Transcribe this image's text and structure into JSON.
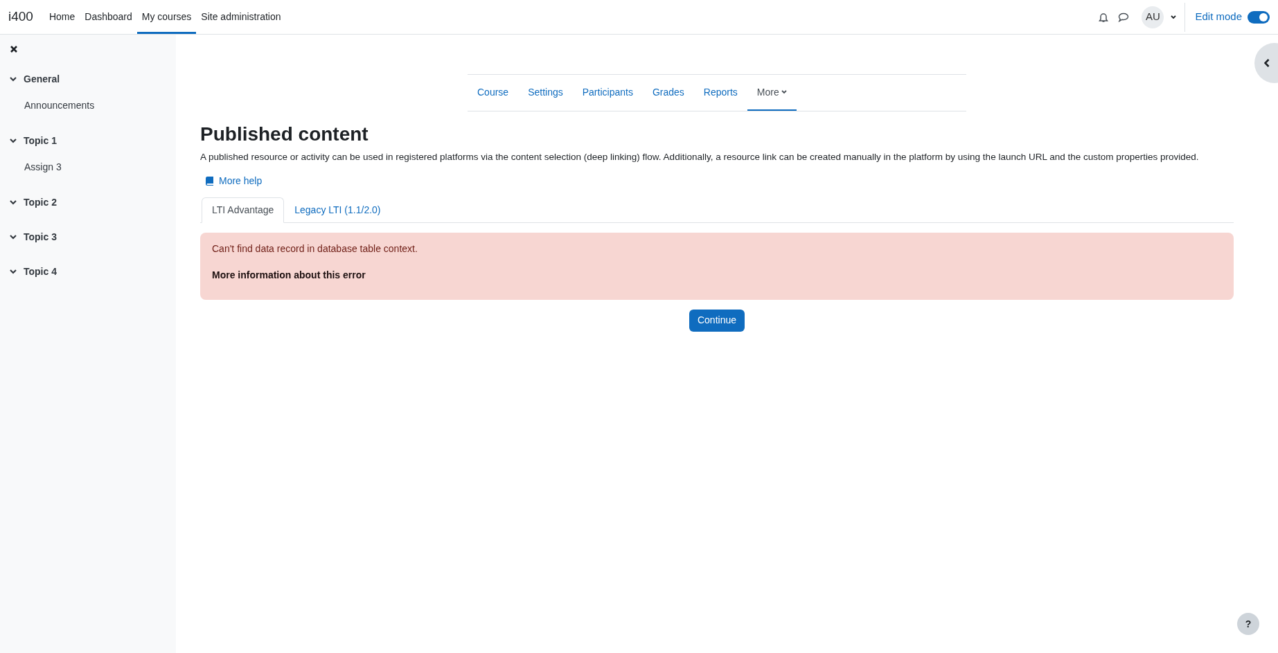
{
  "navbar": {
    "brand": "i400",
    "links": [
      {
        "label": "Home",
        "selected": false
      },
      {
        "label": "Dashboard",
        "selected": false
      },
      {
        "label": "My courses",
        "selected": true
      },
      {
        "label": "Site administration",
        "selected": false
      }
    ],
    "avatar": "AU",
    "edit_mode": {
      "label": "Edit mode",
      "on": true
    }
  },
  "sidebar": {
    "sections": [
      {
        "title": "General",
        "expanded": true,
        "children": [
          {
            "label": "Announcements"
          }
        ]
      },
      {
        "title": "Topic 1",
        "expanded": true,
        "children": [
          {
            "label": "Assign 3"
          }
        ]
      },
      {
        "title": "Topic 2",
        "expanded": true
      },
      {
        "title": "Topic 3",
        "expanded": true
      },
      {
        "title": "Topic 4",
        "expanded": true
      }
    ]
  },
  "course_nav": [
    {
      "label": "Course",
      "selected": false,
      "kind": "link"
    },
    {
      "label": "Settings",
      "selected": false,
      "kind": "link"
    },
    {
      "label": "Participants",
      "selected": false,
      "kind": "link"
    },
    {
      "label": "Grades",
      "selected": false,
      "kind": "link"
    },
    {
      "label": "Reports",
      "selected": false,
      "kind": "link"
    },
    {
      "label": "More",
      "selected": true,
      "kind": "dropdown"
    }
  ],
  "page": {
    "title": "Published content",
    "description": "A published resource or activity can be used in registered platforms via the content selection (deep linking) flow. Additionally, a resource link can be created manually in the platform by using the launch URL and the custom properties provided.",
    "help_link": "More help"
  },
  "tabs": [
    {
      "label": "LTI Advantage",
      "selected": true
    },
    {
      "label": "Legacy LTI (1.1/2.0)",
      "selected": false
    }
  ],
  "error": {
    "message": "Can't find data record in database table context.",
    "details": "More information about this error"
  },
  "continue_button": "Continue",
  "help_button": "?"
}
